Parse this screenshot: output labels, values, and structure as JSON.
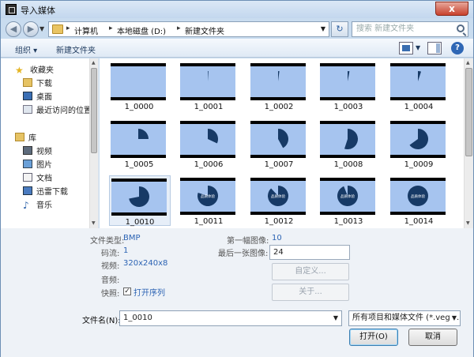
{
  "window": {
    "title": "导入媒体",
    "close_label": "x"
  },
  "address_bar": {
    "crumbs": [
      "计算机",
      "本地磁盘 (D:)",
      "新建文件夹"
    ],
    "search_placeholder": "搜索 新建文件夹"
  },
  "toolbar": {
    "organize_label": "组织 ▾",
    "new_folder_label": "新建文件夹",
    "help_label": "?"
  },
  "sidebar": {
    "favorites_label": "收藏夹",
    "favorites": [
      "下载",
      "桌面",
      "最近访问的位置"
    ],
    "library_label": "库",
    "libraries": [
      "视频",
      "图片",
      "文档",
      "迅雷下载",
      "音乐"
    ]
  },
  "files": [
    {
      "name": "1_0000",
      "fraction": 0.0
    },
    {
      "name": "1_0001",
      "fraction": 0.01
    },
    {
      "name": "1_0002",
      "fraction": 0.02
    },
    {
      "name": "1_0003",
      "fraction": 0.03
    },
    {
      "name": "1_0004",
      "fraction": 0.05
    },
    {
      "name": "1_0005",
      "fraction": 0.25
    },
    {
      "name": "1_0006",
      "fraction": 0.32
    },
    {
      "name": "1_0007",
      "fraction": 0.42
    },
    {
      "name": "1_0008",
      "fraction": 0.55
    },
    {
      "name": "1_0009",
      "fraction": 0.65
    },
    {
      "name": "1_0010",
      "fraction": 0.72,
      "selected": true
    },
    {
      "name": "1_0011",
      "fraction": 0.8,
      "text": "品质体验"
    },
    {
      "name": "1_0012",
      "fraction": 0.88,
      "text": "品质体验"
    },
    {
      "name": "1_0013",
      "fraction": 0.94,
      "text": "品质体验"
    },
    {
      "name": "1_0014",
      "fraction": 1.0,
      "text": "品质体验"
    }
  ],
  "info": {
    "file_type_label": "文件类型:",
    "file_type_value": "BMP",
    "stream_label": "码流:",
    "stream_value": "1",
    "video_label": "视频:",
    "video_value": "320x240x8",
    "audio_label": "音频:",
    "quick_label": "快照:",
    "open_sequence_label": "打开序列",
    "first_image_label": "第一幅图像:",
    "first_image_value": "10",
    "last_image_label": "最后一张图像:",
    "last_image_value": "24",
    "custom_button": "自定义...",
    "about_button": "关于..."
  },
  "bottom": {
    "filename_label": "文件名(N):",
    "filename_value": "1_0010",
    "filter_value": "所有项目和媒体文件 (*.veg;*.m",
    "open_button": "打开(O)",
    "cancel_button": "取消"
  },
  "colors": {
    "frame_bg": "#a6c4ef",
    "pie": "#173a66",
    "accent": "#2d64b4"
  }
}
